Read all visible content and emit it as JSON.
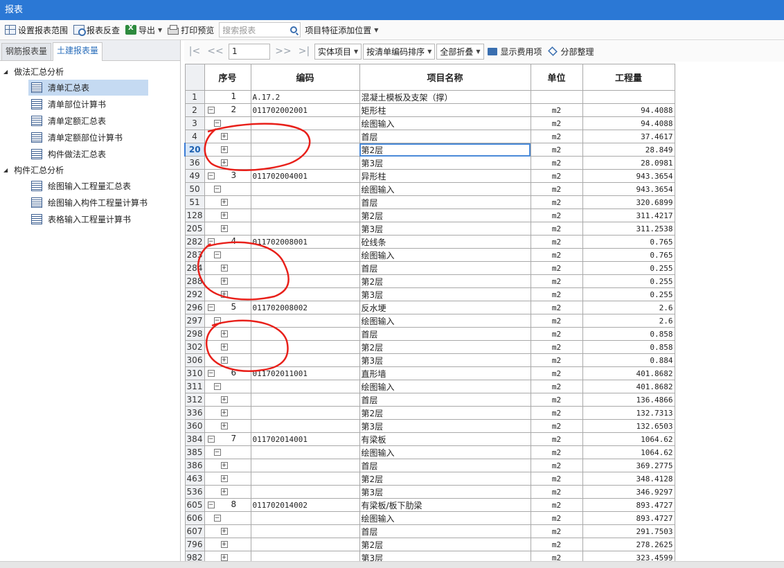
{
  "window": {
    "title": "报表"
  },
  "toolbar": {
    "set_range": "设置报表范围",
    "reverse_check": "报表反查",
    "export": "导出",
    "print_preview": "打印预览",
    "search_placeholder": "搜索报表",
    "feature_pos": "项目特征添加位置"
  },
  "left": {
    "tabs": [
      "钢筋报表量",
      "土建报表量"
    ],
    "active_tab": 1,
    "groups": [
      {
        "label": "做法汇总分析",
        "items": [
          "清单汇总表",
          "清单部位计算书",
          "清单定额汇总表",
          "清单定额部位计算书",
          "构件做法汇总表"
        ]
      },
      {
        "label": "构件汇总分析",
        "items": [
          "绘图输入工程量汇总表",
          "绘图输入构件工程量计算书",
          "表格输入工程量计算书"
        ]
      }
    ],
    "selected_item": "清单汇总表"
  },
  "nav": {
    "page": "1",
    "filter": "实体项目",
    "sort": "按清单编码排序",
    "fold": "全部折叠",
    "show_cost": "显示费用项",
    "section": "分部整理"
  },
  "table": {
    "headers": [
      "序号",
      "编码",
      "项目名称",
      "单位",
      "工程量"
    ],
    "rows": [
      {
        "rn": "1",
        "lvl": 0,
        "seq": "1",
        "code": "A.17.2",
        "name": "混凝土模板及支架（撑）",
        "unit": "",
        "qty": ""
      },
      {
        "rn": "2",
        "lvl": 1,
        "seq": "2",
        "code": "011702002001",
        "name": "矩形柱",
        "unit": "m2",
        "qty": "94.4088"
      },
      {
        "rn": "3",
        "lvl": 2,
        "seq": "",
        "code": "",
        "name": "绘图输入",
        "unit": "m2",
        "qty": "94.4088"
      },
      {
        "rn": "4",
        "lvl": 3,
        "seq": "",
        "code": "",
        "name": "首层",
        "unit": "m2",
        "qty": "37.4617"
      },
      {
        "rn": "20",
        "lvl": 3,
        "seq": "",
        "code": "",
        "name": "第2层",
        "unit": "m2",
        "qty": "28.849",
        "current": true
      },
      {
        "rn": "36",
        "lvl": 3,
        "seq": "",
        "code": "",
        "name": "第3层",
        "unit": "m2",
        "qty": "28.0981"
      },
      {
        "rn": "49",
        "lvl": 1,
        "seq": "3",
        "code": "011702004001",
        "name": "异形柱",
        "unit": "m2",
        "qty": "943.3654"
      },
      {
        "rn": "50",
        "lvl": 2,
        "seq": "",
        "code": "",
        "name": "绘图输入",
        "unit": "m2",
        "qty": "943.3654"
      },
      {
        "rn": "51",
        "lvl": 3,
        "seq": "",
        "code": "",
        "name": "首层",
        "unit": "m2",
        "qty": "320.6899"
      },
      {
        "rn": "128",
        "lvl": 3,
        "seq": "",
        "code": "",
        "name": "第2层",
        "unit": "m2",
        "qty": "311.4217"
      },
      {
        "rn": "205",
        "lvl": 3,
        "seq": "",
        "code": "",
        "name": "第3层",
        "unit": "m2",
        "qty": "311.2538"
      },
      {
        "rn": "282",
        "lvl": 1,
        "seq": "4",
        "code": "011702008001",
        "name": "砼线条",
        "unit": "m2",
        "qty": "0.765"
      },
      {
        "rn": "283",
        "lvl": 2,
        "seq": "",
        "code": "",
        "name": "绘图输入",
        "unit": "m2",
        "qty": "0.765"
      },
      {
        "rn": "284",
        "lvl": 3,
        "seq": "",
        "code": "",
        "name": "首层",
        "unit": "m2",
        "qty": "0.255"
      },
      {
        "rn": "288",
        "lvl": 3,
        "seq": "",
        "code": "",
        "name": "第2层",
        "unit": "m2",
        "qty": "0.255"
      },
      {
        "rn": "292",
        "lvl": 3,
        "seq": "",
        "code": "",
        "name": "第3层",
        "unit": "m2",
        "qty": "0.255"
      },
      {
        "rn": "296",
        "lvl": 1,
        "seq": "5",
        "code": "011702008002",
        "name": "反水埂",
        "unit": "m2",
        "qty": "2.6"
      },
      {
        "rn": "297",
        "lvl": 2,
        "seq": "",
        "code": "",
        "name": "绘图输入",
        "unit": "m2",
        "qty": "2.6"
      },
      {
        "rn": "298",
        "lvl": 3,
        "seq": "",
        "code": "",
        "name": "首层",
        "unit": "m2",
        "qty": "0.858"
      },
      {
        "rn": "302",
        "lvl": 3,
        "seq": "",
        "code": "",
        "name": "第2层",
        "unit": "m2",
        "qty": "0.858"
      },
      {
        "rn": "306",
        "lvl": 3,
        "seq": "",
        "code": "",
        "name": "第3层",
        "unit": "m2",
        "qty": "0.884"
      },
      {
        "rn": "310",
        "lvl": 1,
        "seq": "6",
        "code": "011702011001",
        "name": "直形墙",
        "unit": "m2",
        "qty": "401.8682"
      },
      {
        "rn": "311",
        "lvl": 2,
        "seq": "",
        "code": "",
        "name": "绘图输入",
        "unit": "m2",
        "qty": "401.8682"
      },
      {
        "rn": "312",
        "lvl": 3,
        "seq": "",
        "code": "",
        "name": "首层",
        "unit": "m2",
        "qty": "136.4866"
      },
      {
        "rn": "336",
        "lvl": 3,
        "seq": "",
        "code": "",
        "name": "第2层",
        "unit": "m2",
        "qty": "132.7313"
      },
      {
        "rn": "360",
        "lvl": 3,
        "seq": "",
        "code": "",
        "name": "第3层",
        "unit": "m2",
        "qty": "132.6503"
      },
      {
        "rn": "384",
        "lvl": 1,
        "seq": "7",
        "code": "011702014001",
        "name": "有梁板",
        "unit": "m2",
        "qty": "1064.62"
      },
      {
        "rn": "385",
        "lvl": 2,
        "seq": "",
        "code": "",
        "name": "绘图输入",
        "unit": "m2",
        "qty": "1064.62"
      },
      {
        "rn": "386",
        "lvl": 3,
        "seq": "",
        "code": "",
        "name": "首层",
        "unit": "m2",
        "qty": "369.2775"
      },
      {
        "rn": "463",
        "lvl": 3,
        "seq": "",
        "code": "",
        "name": "第2层",
        "unit": "m2",
        "qty": "348.4128"
      },
      {
        "rn": "536",
        "lvl": 3,
        "seq": "",
        "code": "",
        "name": "第3层",
        "unit": "m2",
        "qty": "346.9297"
      },
      {
        "rn": "605",
        "lvl": 1,
        "seq": "8",
        "code": "011702014002",
        "name": "有梁板/板下肋梁",
        "unit": "m2",
        "qty": "893.4727"
      },
      {
        "rn": "606",
        "lvl": 2,
        "seq": "",
        "code": "",
        "name": "绘图输入",
        "unit": "m2",
        "qty": "893.4727"
      },
      {
        "rn": "607",
        "lvl": 3,
        "seq": "",
        "code": "",
        "name": "首层",
        "unit": "m2",
        "qty": "291.7503"
      },
      {
        "rn": "796",
        "lvl": 3,
        "seq": "",
        "code": "",
        "name": "第2层",
        "unit": "m2",
        "qty": "278.2625"
      },
      {
        "rn": "982",
        "lvl": 3,
        "seq": "",
        "code": "",
        "name": "第3层",
        "unit": "m2",
        "qty": "323.4599"
      }
    ]
  },
  "colors": {
    "titlebar": "#2b78d5",
    "annotation": "#e8201a",
    "selection": "#c5daf2"
  }
}
